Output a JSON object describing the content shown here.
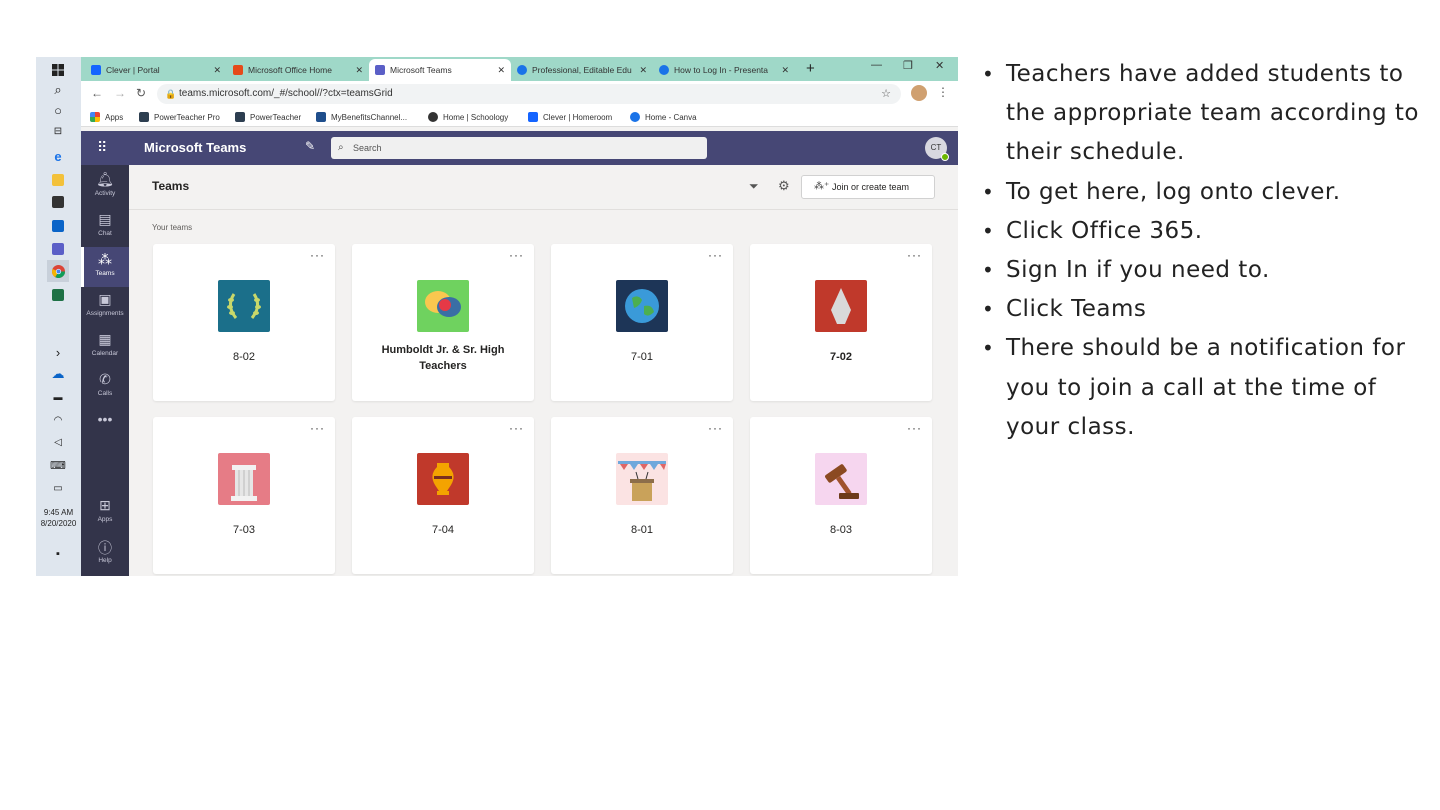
{
  "browser": {
    "tabs": [
      {
        "label": "Clever | Portal",
        "favicon_color": "#1464ff"
      },
      {
        "label": "Microsoft Office Home",
        "favicon_color": "#e64a19"
      },
      {
        "label": "Microsoft Teams",
        "favicon_color": "#5b5fc7"
      },
      {
        "label": "Professional, Editable Edu",
        "favicon_color": "#1a73e8"
      },
      {
        "label": "How to Log In - Presenta",
        "favicon_color": "#1a73e8"
      }
    ],
    "new_tab": "+",
    "url": "teams.microsoft.com/_#/school//?ctx=teamsGrid",
    "bookmarks": [
      {
        "label": "Apps"
      },
      {
        "label": "PowerTeacher Pro"
      },
      {
        "label": "PowerTeacher"
      },
      {
        "label": "MyBenefitsChannel..."
      },
      {
        "label": "Home | Schoology"
      },
      {
        "label": "Clever | Homeroom"
      },
      {
        "label": "Home - Canva"
      }
    ]
  },
  "taskbar": {
    "time": "9:45 AM",
    "date": "8/20/2020"
  },
  "teams": {
    "app_title": "Microsoft Teams",
    "search_placeholder": "Search",
    "avatar_initials": "CT",
    "rail": [
      {
        "label": "Activity",
        "icon": "bell-icon"
      },
      {
        "label": "Chat",
        "icon": "chat-icon"
      },
      {
        "label": "Teams",
        "icon": "teams-icon"
      },
      {
        "label": "Assignments",
        "icon": "assignments-icon"
      },
      {
        "label": "Calendar",
        "icon": "calendar-icon"
      },
      {
        "label": "Calls",
        "icon": "phone-icon"
      }
    ],
    "rail_bottom": [
      {
        "label": "Apps",
        "icon": "apps-icon"
      },
      {
        "label": "Help",
        "icon": "help-icon"
      }
    ],
    "page_title": "Teams",
    "join_button": "Join or create team",
    "section_label": "Your teams",
    "cards": [
      {
        "name": "8-02",
        "tile": "laurel",
        "color": "#1b6f8a"
      },
      {
        "name": "Humboldt Jr. & Sr. High Teachers",
        "tile": "chat",
        "color": "#6fd25f"
      },
      {
        "name": "7-01",
        "tile": "globe",
        "color": "#1d3557"
      },
      {
        "name": "7-02",
        "tile": "arrowhead",
        "color": "#c0392b"
      },
      {
        "name": "7-03",
        "tile": "column",
        "color": "#e67c86"
      },
      {
        "name": "7-04",
        "tile": "vase",
        "color": "#c0392b"
      },
      {
        "name": "8-01",
        "tile": "podium",
        "color": "#fbe3e3"
      },
      {
        "name": "8-03",
        "tile": "gavel",
        "color": "#f6d6ef"
      }
    ]
  },
  "bullets": [
    "Teachers have added students to the appropriate team according to their schedule.",
    "To get here, log onto clever.",
    "Click Office 365.",
    "Sign In if you need to.",
    "Click Teams",
    "There should be a notification for you to join a call at the time of your class."
  ]
}
